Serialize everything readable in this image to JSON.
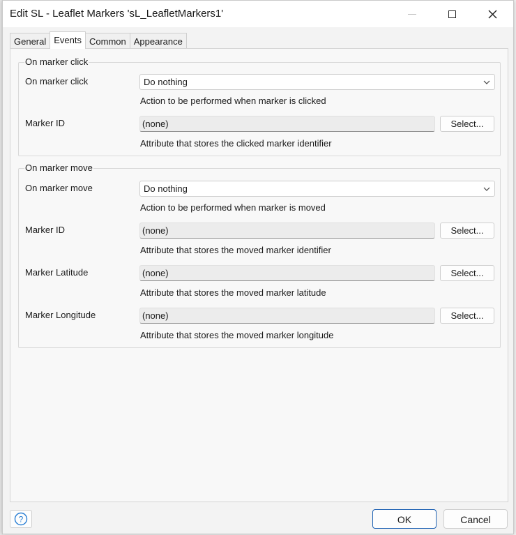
{
  "window": {
    "title": "Edit SL - Leaflet Markers 'sL_LeafletMarkers1'",
    "minimize_icon": "minimize-icon",
    "maximize_icon": "maximize-icon",
    "close_icon": "close-icon"
  },
  "tabs": [
    {
      "label": "General",
      "active": false
    },
    {
      "label": "Events",
      "active": true
    },
    {
      "label": "Common",
      "active": false
    },
    {
      "label": "Appearance",
      "active": false
    }
  ],
  "click_group": {
    "title": "On marker click",
    "action": {
      "label": "On marker click",
      "value": "Do nothing",
      "hint": "Action to be performed when marker is clicked"
    },
    "marker_id": {
      "label": "Marker ID",
      "value": "(none)",
      "button": "Select...",
      "hint": "Attribute that stores the clicked marker identifier"
    }
  },
  "move_group": {
    "title": "On marker move",
    "action": {
      "label": "On marker move",
      "value": "Do nothing",
      "hint": "Action to be performed when marker is moved"
    },
    "marker_id": {
      "label": "Marker ID",
      "value": "(none)",
      "button": "Select...",
      "hint": "Attribute that stores the moved marker identifier"
    },
    "latitude": {
      "label": "Marker Latitude",
      "value": "(none)",
      "button": "Select...",
      "hint": "Attribute that stores the moved marker latitude"
    },
    "longitude": {
      "label": "Marker Longitude",
      "value": "(none)",
      "button": "Select...",
      "hint": "Attribute that stores the moved marker longitude"
    }
  },
  "footer": {
    "help_icon": "help-icon",
    "ok": "OK",
    "cancel": "Cancel"
  },
  "colors": {
    "accent": "#1f62b3",
    "help": "#2a7fd4"
  }
}
